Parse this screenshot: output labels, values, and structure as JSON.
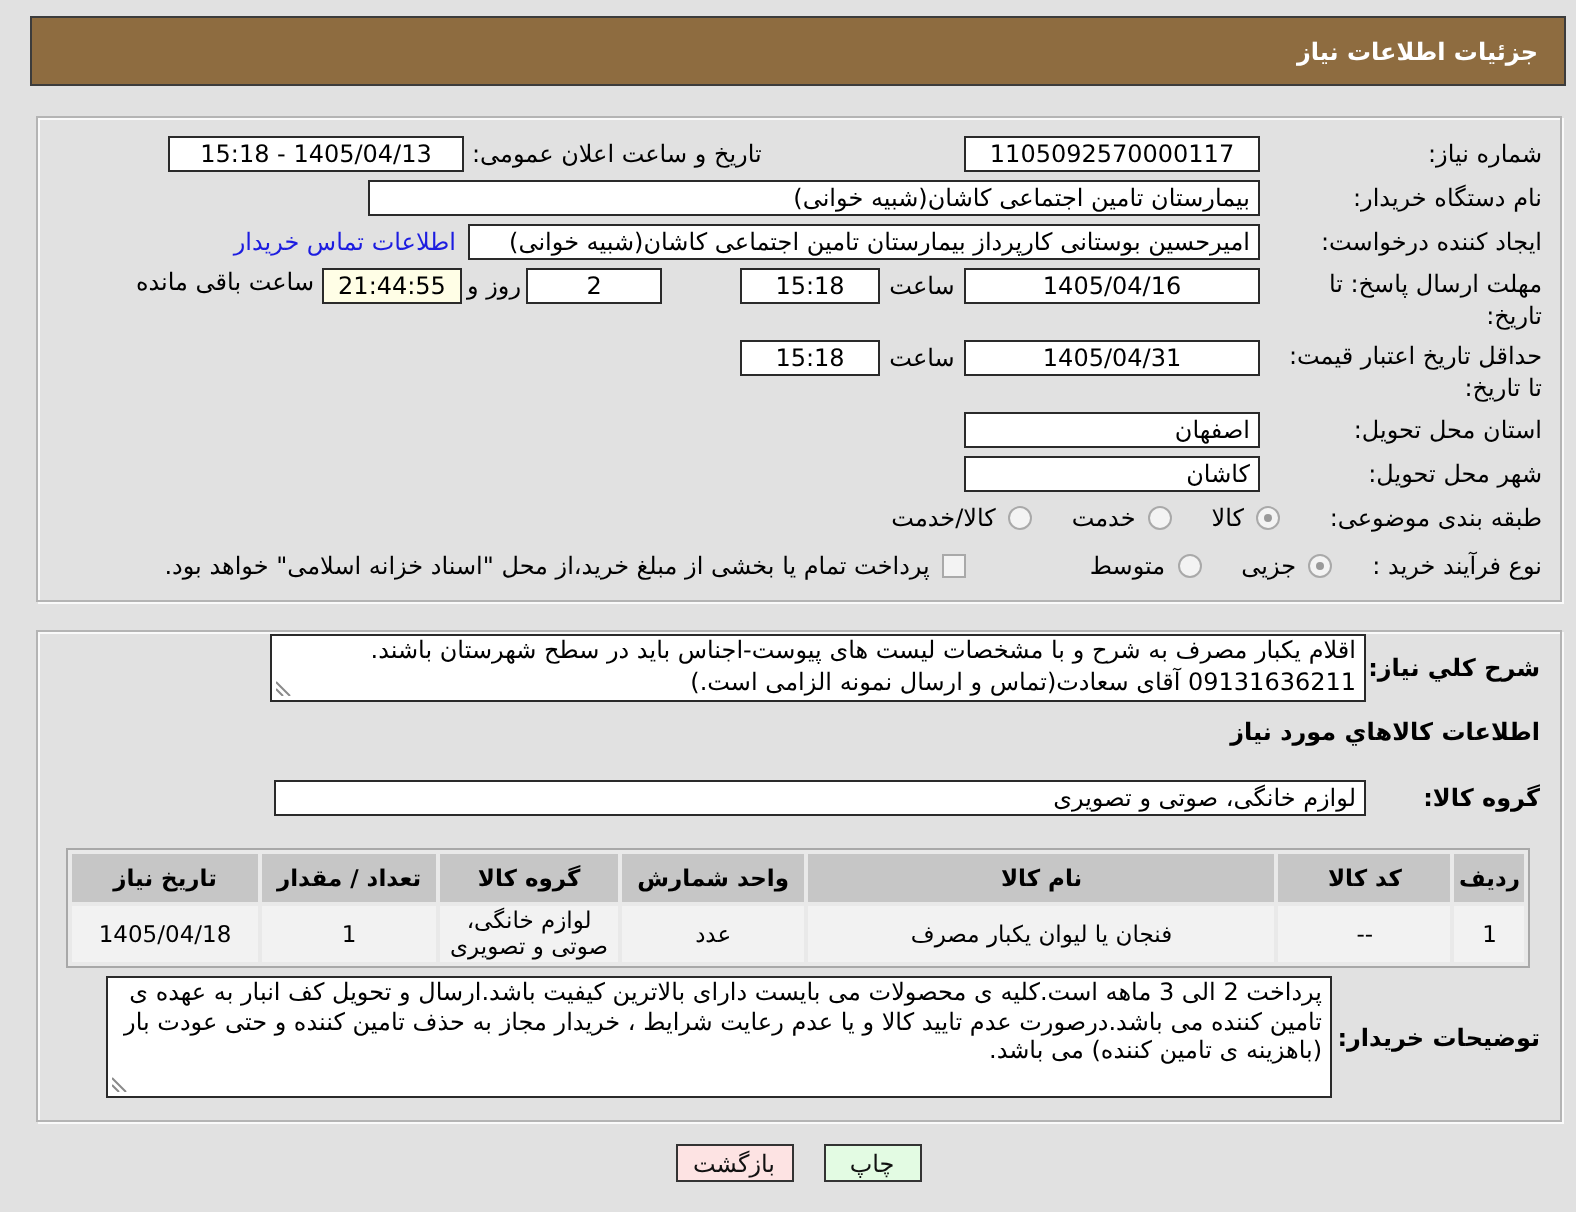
{
  "header": {
    "title": "جزئیات اطلاعات نیاز"
  },
  "details": {
    "need_number": {
      "label": "شماره نیاز:",
      "value": "1105092570000117"
    },
    "announcement": {
      "label": "تاریخ و ساعت اعلان عمومی:",
      "value": "1405/04/13 - 15:18"
    },
    "buyer_org": {
      "label": "نام دستگاه خریدار:",
      "value": "بیمارستان تامین اجتماعی کاشان(شبیه خوانی)"
    },
    "requester": {
      "label": "ایجاد کننده درخواست:",
      "value": "امیرحسین بوستانی کارپرداز بیمارستان تامین اجتماعی کاشان(شبیه خوانی)",
      "contact_link": "اطلاعات تماس خریدار"
    },
    "reply_deadline": {
      "label": "مهلت ارسال پاسخ: تا تاریخ:",
      "date": "1405/04/16",
      "time_label": "ساعت",
      "time": "15:18",
      "days": "2",
      "days_label": "روز و",
      "remaining": "21:44:55",
      "remaining_label": "ساعت باقی مانده"
    },
    "price_validity": {
      "label": "حداقل تاریخ اعتبار قیمت: تا تاریخ:",
      "date": "1405/04/31",
      "time_label": "ساعت",
      "time": "15:18"
    },
    "delivery_province": {
      "label": "استان محل تحویل:",
      "value": "اصفهان"
    },
    "delivery_city": {
      "label": "شهر محل تحویل:",
      "value": "کاشان"
    },
    "category": {
      "label": "طبقه بندی موضوعی:",
      "options": [
        {
          "label": "کالا",
          "selected": true,
          "disabled": true
        },
        {
          "label": "خدمت",
          "selected": false,
          "disabled": true
        },
        {
          "label": "کالا/خدمت",
          "selected": false,
          "disabled": true
        }
      ]
    },
    "purchase_process": {
      "label": "نوع فرآیند خرید :",
      "options": [
        {
          "label": "جزیی",
          "selected": true,
          "disabled": true
        },
        {
          "label": "متوسط",
          "selected": false,
          "disabled": true
        }
      ],
      "treasury_payment": {
        "label": "پرداخت تمام یا بخشی از مبلغ خرید،از محل \"اسناد خزانه اسلامی\" خواهد بود.",
        "checked": false,
        "disabled": true
      }
    }
  },
  "need": {
    "description": {
      "label": "شرح کلي نیاز:",
      "value": "اقلام یکبار مصرف به شرح و با مشخصات لیست های پیوست-اجناس باید در سطح شهرستان باشند. 09131636211 آقای سعادت(تماس و ارسال نمونه الزامی است.)"
    },
    "items_heading": "اطلاعات کالاهاي مورد نیاز",
    "goods_group": {
      "label": "گروه کالا:",
      "value": "لوازم خانگی، صوتی و تصویری"
    },
    "table": {
      "columns": [
        "ردیف",
        "کد کالا",
        "نام کالا",
        "واحد شمارش",
        "گروه کالا",
        "تعداد / مقدار",
        "تاریخ نیاز"
      ],
      "rows": [
        {
          "cells": [
            "1",
            "--",
            "فنجان یا لیوان یکبار مصرف",
            "عدد",
            "لوازم خانگی، صوتی و تصویری",
            "1",
            "1405/04/18"
          ]
        }
      ]
    },
    "buyer_notes": {
      "label": "توضیحات خریدار:",
      "value": "پرداخت 2 الی 3 ماهه است.کلیه ی محصولات می بایست دارای بالاترین کیفیت باشد.ارسال و تحویل کف انبار به عهده ی تامین کننده می باشد.درصورت عدم تایید کالا و یا عدم رعایت شرایط ، خریدار مجاز به حذف تامین کننده و حتی عودت بار (باهزینه ی تامین کننده) می باشد."
    }
  },
  "buttons": [
    {
      "kind": "print",
      "label": "چاپ"
    },
    {
      "kind": "back",
      "label": "بازگشت"
    }
  ]
}
